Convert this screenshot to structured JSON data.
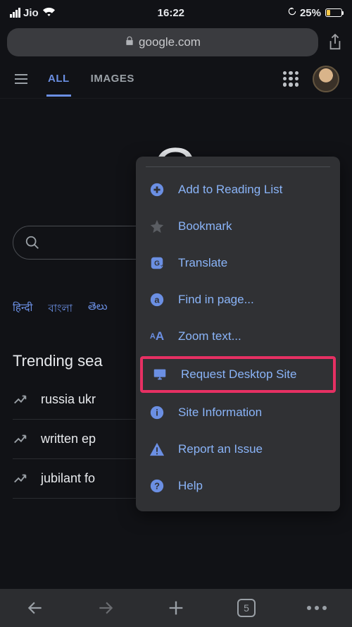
{
  "status": {
    "carrier": "Jio",
    "time": "16:22",
    "battery_pct": "25%"
  },
  "url": {
    "host": "google.com"
  },
  "nav": {
    "tab_all": "ALL",
    "tab_images": "IMAGES"
  },
  "logo_text": "G",
  "languages": [
    "हिन्दी",
    "বাংলা",
    "తెలు"
  ],
  "trending": {
    "title": "Trending sea",
    "items": [
      "russia ukr",
      "written ep",
      "jubilant fo"
    ]
  },
  "menu": {
    "items": [
      {
        "icon": "plus-circle",
        "label": "Add to Reading List"
      },
      {
        "icon": "star",
        "label": "Bookmark"
      },
      {
        "icon": "translate",
        "label": "Translate"
      },
      {
        "icon": "find",
        "label": "Find in page..."
      },
      {
        "icon": "zoom-text",
        "label": "Zoom text..."
      },
      {
        "icon": "desktop",
        "label": "Request Desktop Site",
        "highlight": true
      },
      {
        "icon": "info",
        "label": "Site Information"
      },
      {
        "icon": "warning",
        "label": "Report an Issue"
      },
      {
        "icon": "help",
        "label": "Help"
      }
    ]
  },
  "bottom": {
    "tab_count": "5"
  }
}
